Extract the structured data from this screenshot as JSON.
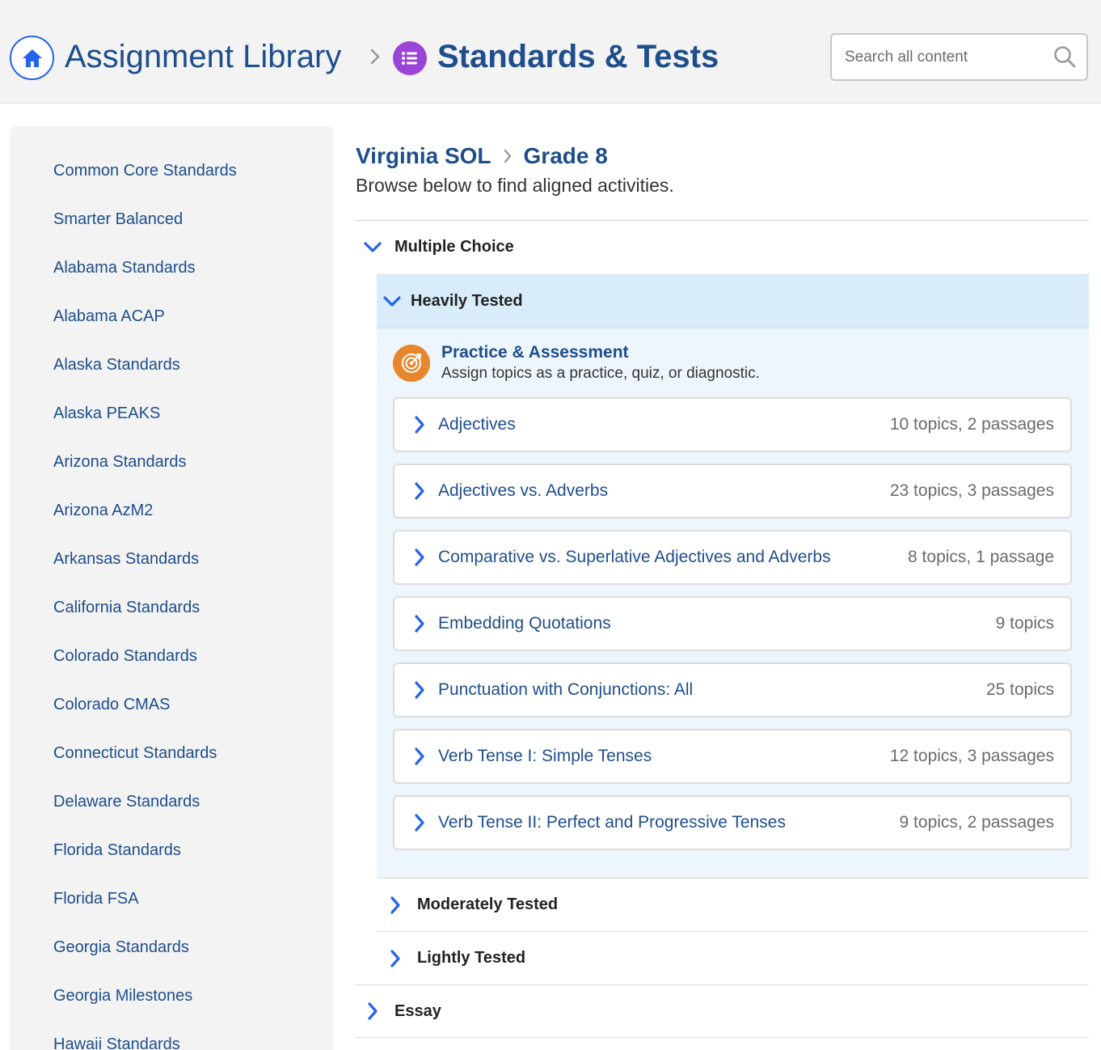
{
  "header": {
    "home_icon": "home-icon",
    "library_label": "Assignment Library",
    "separator_icon": "chevron-right-icon",
    "section_icon": "list-icon",
    "section_label": "Standards & Tests",
    "search": {
      "placeholder": "Search all content",
      "icon": "search-icon"
    }
  },
  "colors": {
    "accent": "#2563eb",
    "link": "#1e4e8c",
    "section_icon_bg": "#9b44d8",
    "practice_icon_bg": "#e8862c",
    "highlight_bg": "#d9ecfa"
  },
  "sidebar": {
    "items": [
      "Common Core Standards",
      "Smarter Balanced",
      "Alabama Standards",
      "Alabama ACAP",
      "Alaska Standards",
      "Alaska PEAKS",
      "Arizona Standards",
      "Arizona AzM2",
      "Arkansas Standards",
      "California Standards",
      "Colorado Standards",
      "Colorado CMAS",
      "Connecticut Standards",
      "Delaware Standards",
      "Florida Standards",
      "Florida FSA",
      "Georgia Standards",
      "Georgia Milestones",
      "Hawaii Standards"
    ]
  },
  "main": {
    "breadcrumb": {
      "standard": "Virginia SOL",
      "grade": "Grade 8"
    },
    "subtitle": "Browse below to find aligned activities.",
    "sections": {
      "multiple_choice": "Multiple Choice",
      "heavily_tested": "Heavily Tested",
      "moderately_tested": "Moderately Tested",
      "lightly_tested": "Lightly Tested",
      "essay": "Essay"
    },
    "practice": {
      "icon": "target-icon",
      "title": "Practice & Assessment",
      "description": "Assign topics as a practice, quiz, or diagnostic."
    },
    "topics": [
      {
        "name": "Adjectives",
        "count": "10 topics, 2 passages"
      },
      {
        "name": "Adjectives vs. Adverbs",
        "count": "23 topics, 3 passages"
      },
      {
        "name": "Comparative vs. Superlative Adjectives and Adverbs",
        "count": "8 topics, 1 passage"
      },
      {
        "name": "Embedding Quotations",
        "count": "9 topics"
      },
      {
        "name": "Punctuation with Conjunctions: All",
        "count": "25 topics"
      },
      {
        "name": "Verb Tense I: Simple Tenses",
        "count": "12 topics, 3 passages"
      },
      {
        "name": "Verb Tense II: Perfect and Progressive Tenses",
        "count": "9 topics, 2 passages"
      }
    ]
  }
}
